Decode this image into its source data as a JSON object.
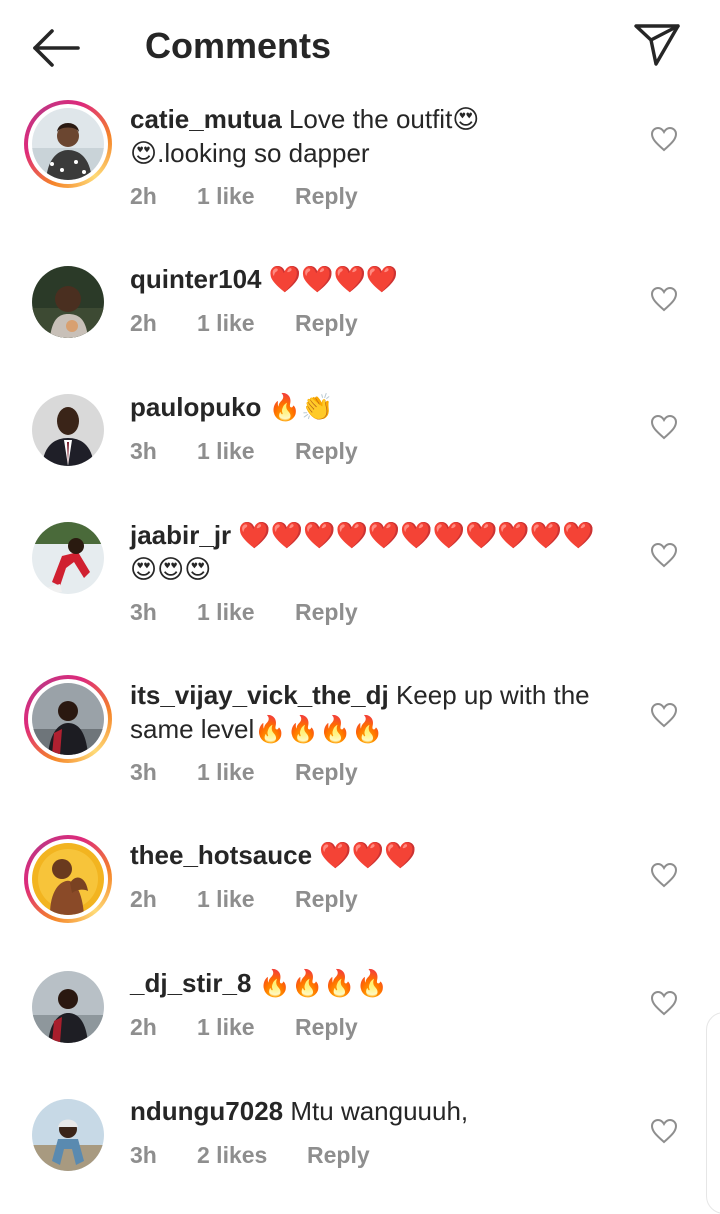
{
  "header": {
    "title": "Comments",
    "back_icon": "arrow-left-icon",
    "send_icon": "paper-plane-icon"
  },
  "colors": {
    "text": "#262626",
    "meta": "#8e8e8e",
    "story_ring_start": "#f58529",
    "story_ring_end": "#dd2a7b"
  },
  "comments": [
    {
      "username": "catie_mutua",
      "text_line1": "Love the outfit😍",
      "text_line2": "😍.looking so dapper",
      "time": "2h",
      "likes": "1 like",
      "reply": "Reply",
      "story_ring": true
    },
    {
      "username": "quinter104",
      "text_line1": "❤️❤️❤️❤️",
      "time": "2h",
      "likes": "1 like",
      "reply": "Reply",
      "story_ring": false
    },
    {
      "username": "paulopuko",
      "text_line1": "🔥👏",
      "time": "3h",
      "likes": "1 like",
      "reply": "Reply",
      "story_ring": false
    },
    {
      "username": "jaabir_jr",
      "text_line1": "❤️❤️❤️❤️❤️❤️❤️❤️❤️❤️❤️",
      "text_line2": "😍😍😍",
      "time": "3h",
      "likes": "1 like",
      "reply": "Reply",
      "story_ring": false
    },
    {
      "username": "its_vijay_vick_the_dj",
      "text_line1": "Keep up with the",
      "text_line2": "same level🔥🔥🔥🔥",
      "time": "3h",
      "likes": "1 like",
      "reply": "Reply",
      "story_ring": true
    },
    {
      "username": "thee_hotsauce",
      "text_line1": "❤️❤️❤️",
      "time": "2h",
      "likes": "1 like",
      "reply": "Reply",
      "story_ring": true
    },
    {
      "username": "_dj_stir_8",
      "text_line1": "🔥🔥🔥🔥",
      "time": "2h",
      "likes": "1 like",
      "reply": "Reply",
      "story_ring": false
    },
    {
      "username": "ndungu7028",
      "text_line1": "Mtu wanguuuh,",
      "time": "3h",
      "likes": "2 likes",
      "reply": "Reply",
      "story_ring": false
    }
  ]
}
